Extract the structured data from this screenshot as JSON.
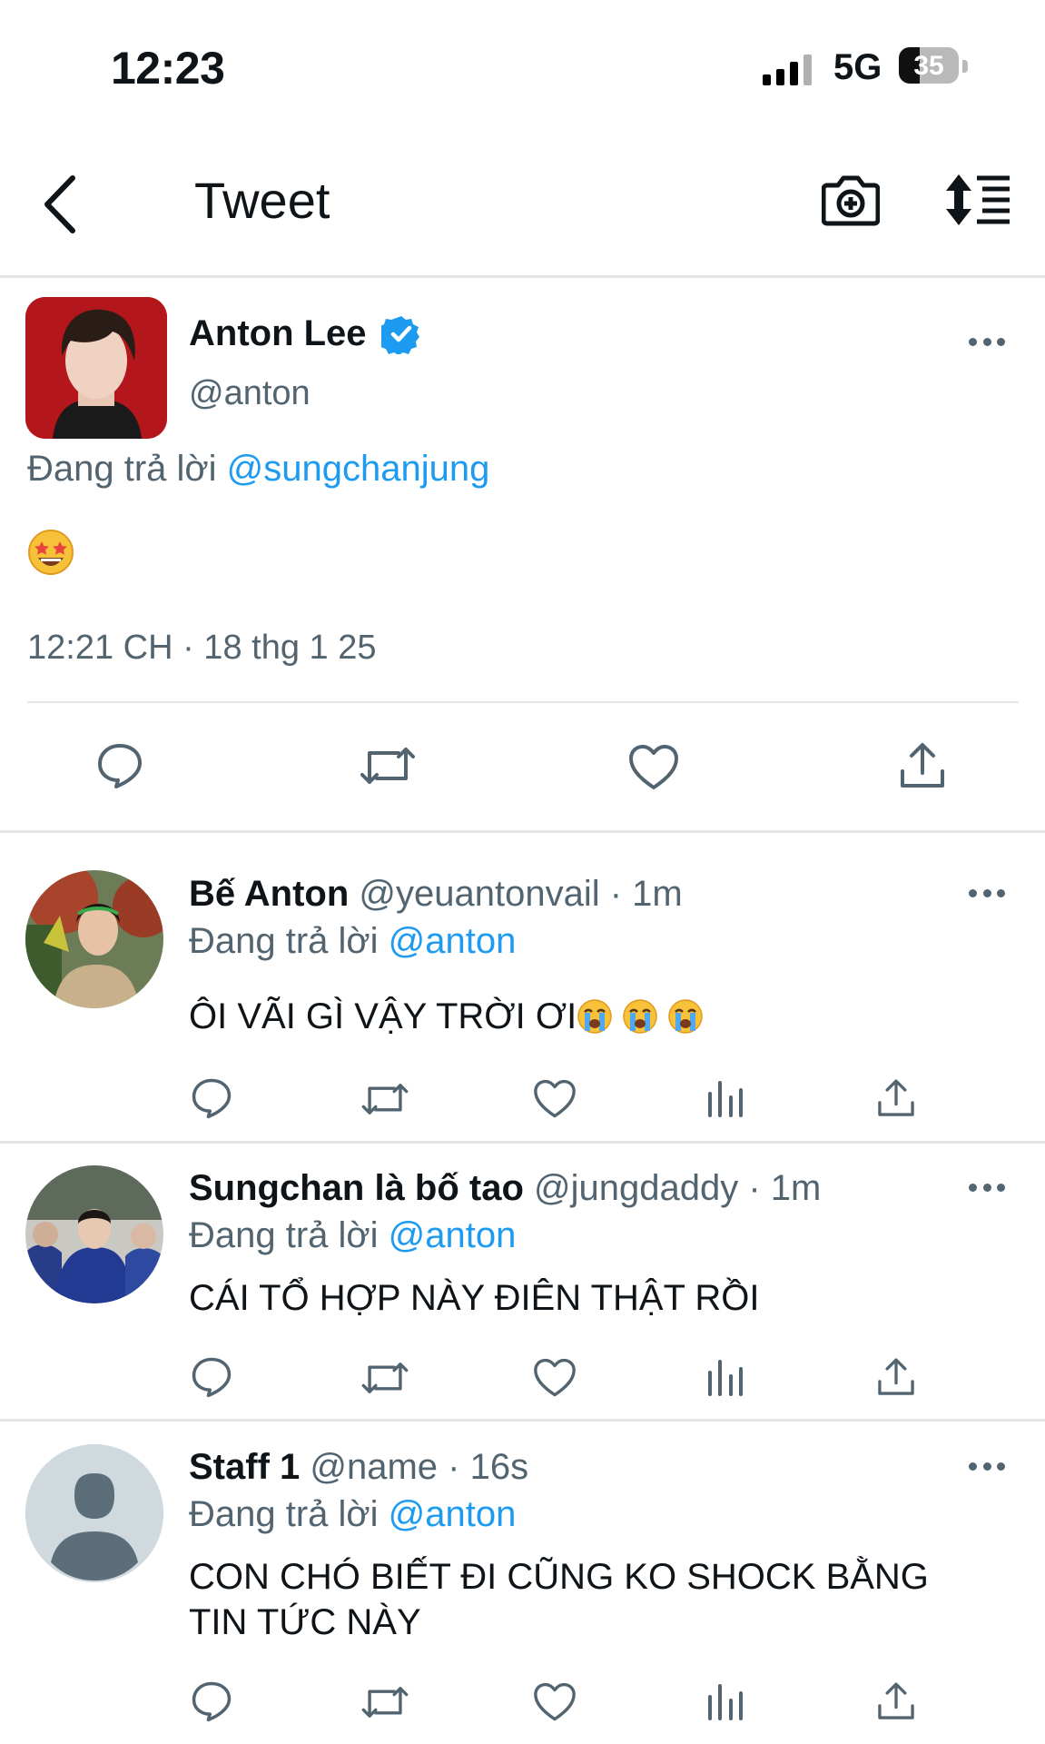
{
  "status_bar": {
    "time": "12:23",
    "network": "5G",
    "battery_level": "35",
    "battery_fraction": 0.35
  },
  "header": {
    "title": "Tweet"
  },
  "main_tweet": {
    "name": "Anton Lee",
    "handle": "@anton",
    "replying_prefix": "Đang trả lời ",
    "replying_to": "@sungchanjung",
    "emoji": "star-struck",
    "timestamp": "12:21 CH · 18 thg 1 25"
  },
  "replies": [
    {
      "name": "Bế Anton",
      "handle": "@yeuantonvail",
      "time": "· 1m",
      "replying_prefix": "Đang trả lời ",
      "replying_to": "@anton",
      "text": "ÔI VÃI GÌ VẬY TRỜI ƠI",
      "emojis": [
        "loudly-crying",
        "loudly-crying",
        "loudly-crying"
      ]
    },
    {
      "name": "Sungchan là bố tao",
      "handle": "@jungdaddy",
      "time": "· 1m",
      "replying_prefix": "Đang trả lời ",
      "replying_to": "@anton",
      "text": "CÁI TỔ HỢP NÀY ĐIÊN THẬT RỒI"
    },
    {
      "name": "Staff 1",
      "handle": "@name",
      "time": "· 16s",
      "replying_prefix": "Đang trả lời ",
      "replying_to": "@anton",
      "text": "CON CHÓ BIẾT ĐI CŨNG KO SHOCK BẰNG TIN TỨC NÀY"
    }
  ],
  "colors": {
    "link": "#1d9bf0",
    "muted": "#536471",
    "verified": "#1d9bf0",
    "text": "#0f1419"
  },
  "icons": [
    "back-arrow-icon",
    "camera-plus-icon",
    "sort-icon",
    "verified-badge-icon",
    "reply-icon",
    "retweet-icon",
    "like-icon",
    "views-icon",
    "share-icon",
    "more-icon"
  ]
}
